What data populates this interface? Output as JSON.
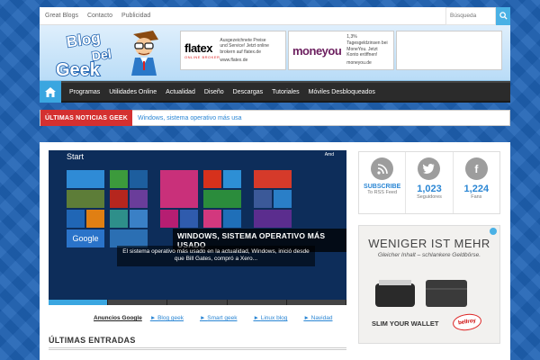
{
  "topbar": {
    "links": [
      "Great Blogs",
      "Contacto",
      "Publicidad"
    ],
    "search_placeholder": "Búsqueda"
  },
  "logo": {
    "line1": "Blog",
    "line2": "Del",
    "line3": "Geek"
  },
  "ads": [
    {
      "brand": "flatex",
      "sub": "ONLINE BROKER",
      "text": "Ausgezeichnete Preise und Service! Jetzt online brokern auf flatex.de",
      "domain": "www.flatex.de"
    },
    {
      "brand": "moneyou",
      "text": "1,3% Tagesgeldzinsen bei MoneYou. Jetzt Konto eröffnen!",
      "domain": "moneyou.de"
    }
  ],
  "nav": {
    "items": [
      "Programas",
      "Utilidades Online",
      "Actualidad",
      "Diseño",
      "Descargas",
      "Tutoriales",
      "Móviles Desbloqueados"
    ]
  },
  "ticker": {
    "tag": "ÚLTIMAS NOTICIAS GEEK",
    "headline": "Windows, sistema operativo más usa"
  },
  "slider": {
    "screen_label": "Start",
    "user_label": "Amd",
    "title": "WINDOWS, SISTEMA OPERATIVO MÁS USADO",
    "text": "El sistema operativo más usado en la actualidad, Windows, inició desde que Bill Gates, compró a Xero...",
    "google_tile": "Google",
    "slides": 5,
    "active_slide": 1
  },
  "links": [
    "Anuncios Google",
    "Blog geek",
    "Smart geek",
    "Linux blog",
    "Navidad"
  ],
  "section_title": "ÚLTIMAS ENTRADAS",
  "social": [
    {
      "icon": "rss-icon",
      "big": "SUBSCRIBE",
      "small": "To RSS Feed"
    },
    {
      "icon": "twitter-icon",
      "big": "1,023",
      "small": "Seguidores"
    },
    {
      "icon": "facebook-icon",
      "big": "1,224",
      "small": "Fans"
    }
  ],
  "side_ad": {
    "headline": "WENIGER IST MEHR",
    "sub": "Gleicher Inhalt – schlankere Geldbörse.",
    "cta": "SLIM YOUR WALLET",
    "brand": "bellroy"
  },
  "colors": {
    "accent": "#3aa6e0",
    "ticker_tag": "#d43030",
    "nav_bg": "#2b2b2b",
    "background": "#1e62b4"
  }
}
